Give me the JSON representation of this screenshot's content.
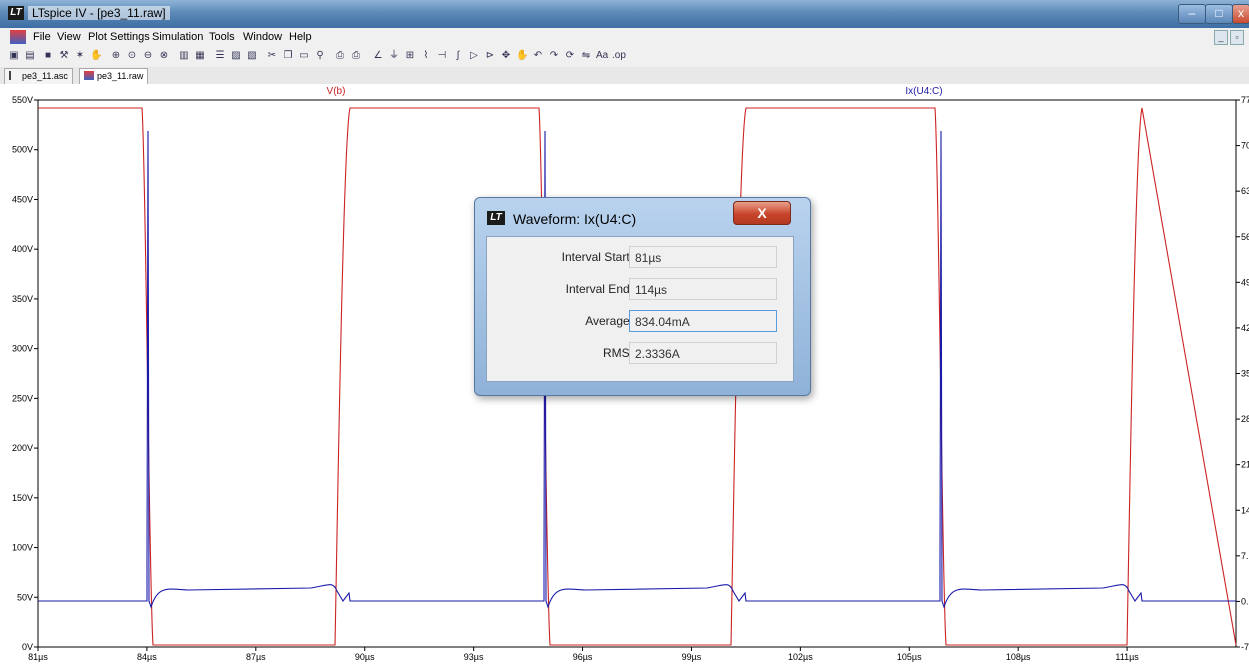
{
  "window": {
    "title": "LTspice IV - [pe3_11.raw]"
  },
  "menu": [
    "File",
    "View",
    "Plot Settings",
    "Simulation",
    "Tools",
    "Window",
    "Help"
  ],
  "tabs": [
    "pe3_11.asc",
    "pe3_11.raw"
  ],
  "plot": {
    "traces": [
      {
        "name": "V(b)",
        "color": "#cc2222"
      },
      {
        "name": "Ix(U4:C)",
        "color": "#1a1aaa"
      }
    ],
    "left_axis_ticks": [
      "550V",
      "500V",
      "450V",
      "400V",
      "350V",
      "300V",
      "250V",
      "200V",
      "150V",
      "100V",
      "50V",
      "0V"
    ],
    "right_axis_ticks": [
      "77.",
      "70.",
      "63.",
      "56.",
      "49.",
      "42.",
      "35.",
      "28.",
      "21.",
      "14.",
      "7.",
      "0.",
      "-7."
    ],
    "x_axis_ticks": [
      "81µs",
      "84µs",
      "87µs",
      "90µs",
      "93µs",
      "96µs",
      "99µs",
      "102µs",
      "105µs",
      "108µs",
      "111µs"
    ]
  },
  "dialog": {
    "title": "Waveform: Ix(U4:C)",
    "close_label": "X",
    "rows": [
      {
        "label": "Interval Start:",
        "value": "81µs"
      },
      {
        "label": "Interval End:",
        "value": "114µs"
      },
      {
        "label": "Average:",
        "value": "834.04mA"
      },
      {
        "label": "RMS:",
        "value": "2.3336A"
      }
    ]
  }
}
